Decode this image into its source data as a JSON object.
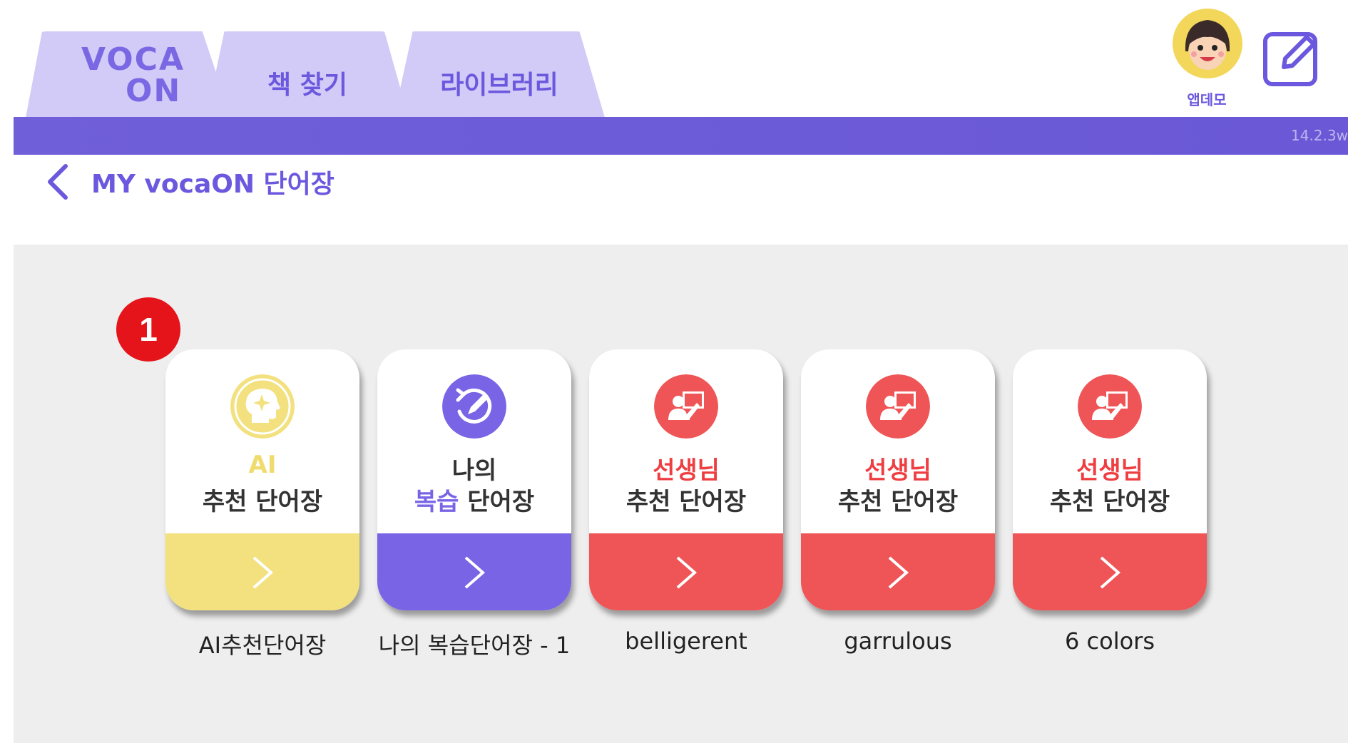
{
  "header": {
    "logo_top": "VOCA",
    "logo_bottom": "ON",
    "tabs": [
      {
        "label": "책 찾기"
      },
      {
        "label": "라이브러리"
      }
    ],
    "user_name": "앱데모",
    "version": "14.2.3w"
  },
  "page": {
    "title": "MY vocaON 단어장",
    "step_badge": "1"
  },
  "cards": [
    {
      "line1": "AI",
      "line2": "추천 단어장",
      "caption": "AI추천단어장",
      "accent": "#f2e17e",
      "title_color": "#f0dc6e"
    },
    {
      "line1": "나의",
      "line2_highlight": "복습",
      "line2": " 단어장",
      "caption": "나의 복습단어장 - 1",
      "accent": "#7a64e6",
      "title_color": "#333333"
    },
    {
      "line1": "선생님",
      "line2": "추천 단어장",
      "caption": "belligerent",
      "accent": "#ef5456",
      "title_color": "#ef3e42"
    },
    {
      "line1": "선생님",
      "line2": "추천 단어장",
      "caption": "garrulous",
      "accent": "#ef5456",
      "title_color": "#ef3e42"
    },
    {
      "line1": "선생님",
      "line2": "추천 단어장",
      "caption": "6 colors",
      "accent": "#ef5456",
      "title_color": "#ef3e42"
    }
  ],
  "colors": {
    "brand": "#6b58de",
    "tab_bg": "#d2caf7",
    "badge": "#e4141a"
  },
  "icons": [
    "pencil-square-icon",
    "back-chevron-icon",
    "ai-head-icon",
    "review-icon",
    "teacher-icon",
    "chevron-right-icon"
  ]
}
